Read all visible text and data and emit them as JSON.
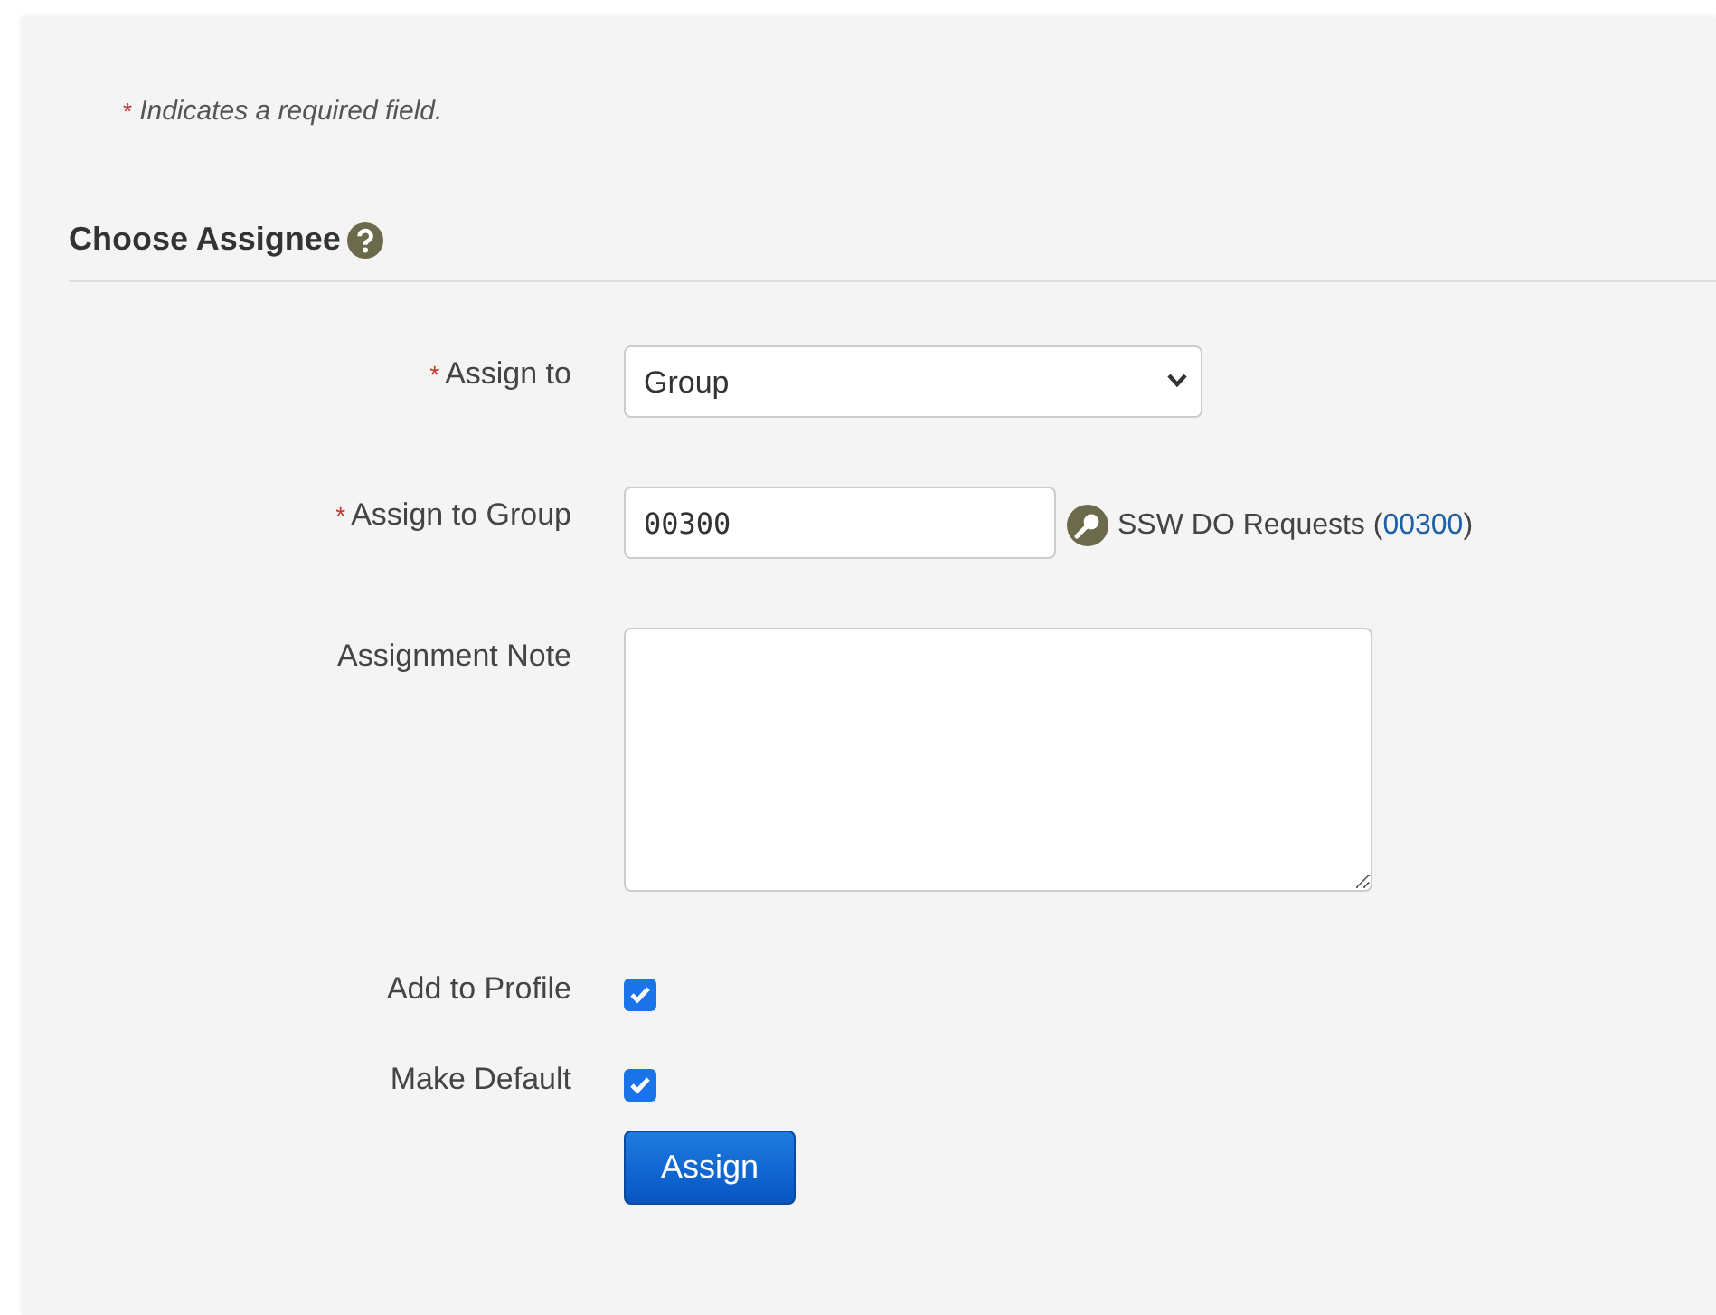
{
  "note": {
    "mark": "*",
    "text": "Indicates a required field."
  },
  "section": {
    "title": "Choose Assignee"
  },
  "fields": [
    {
      "kind": "select",
      "required_mark": "*",
      "label": "Assign to",
      "value": "Group"
    },
    {
      "kind": "text",
      "required_mark": "*",
      "label": "Assign to Group",
      "value": "00300",
      "lookup": {
        "prefix": "SSW DO Requests (",
        "link": "00300",
        "suffix": ")"
      }
    },
    {
      "kind": "textarea",
      "label": "Assignment Note"
    },
    {
      "kind": "checkbox",
      "label": "Add to Profile",
      "checked": true
    },
    {
      "kind": "checkbox",
      "label": "Make Default",
      "checked": true
    }
  ],
  "buttons": [
    {
      "label": "Assign"
    }
  ]
}
